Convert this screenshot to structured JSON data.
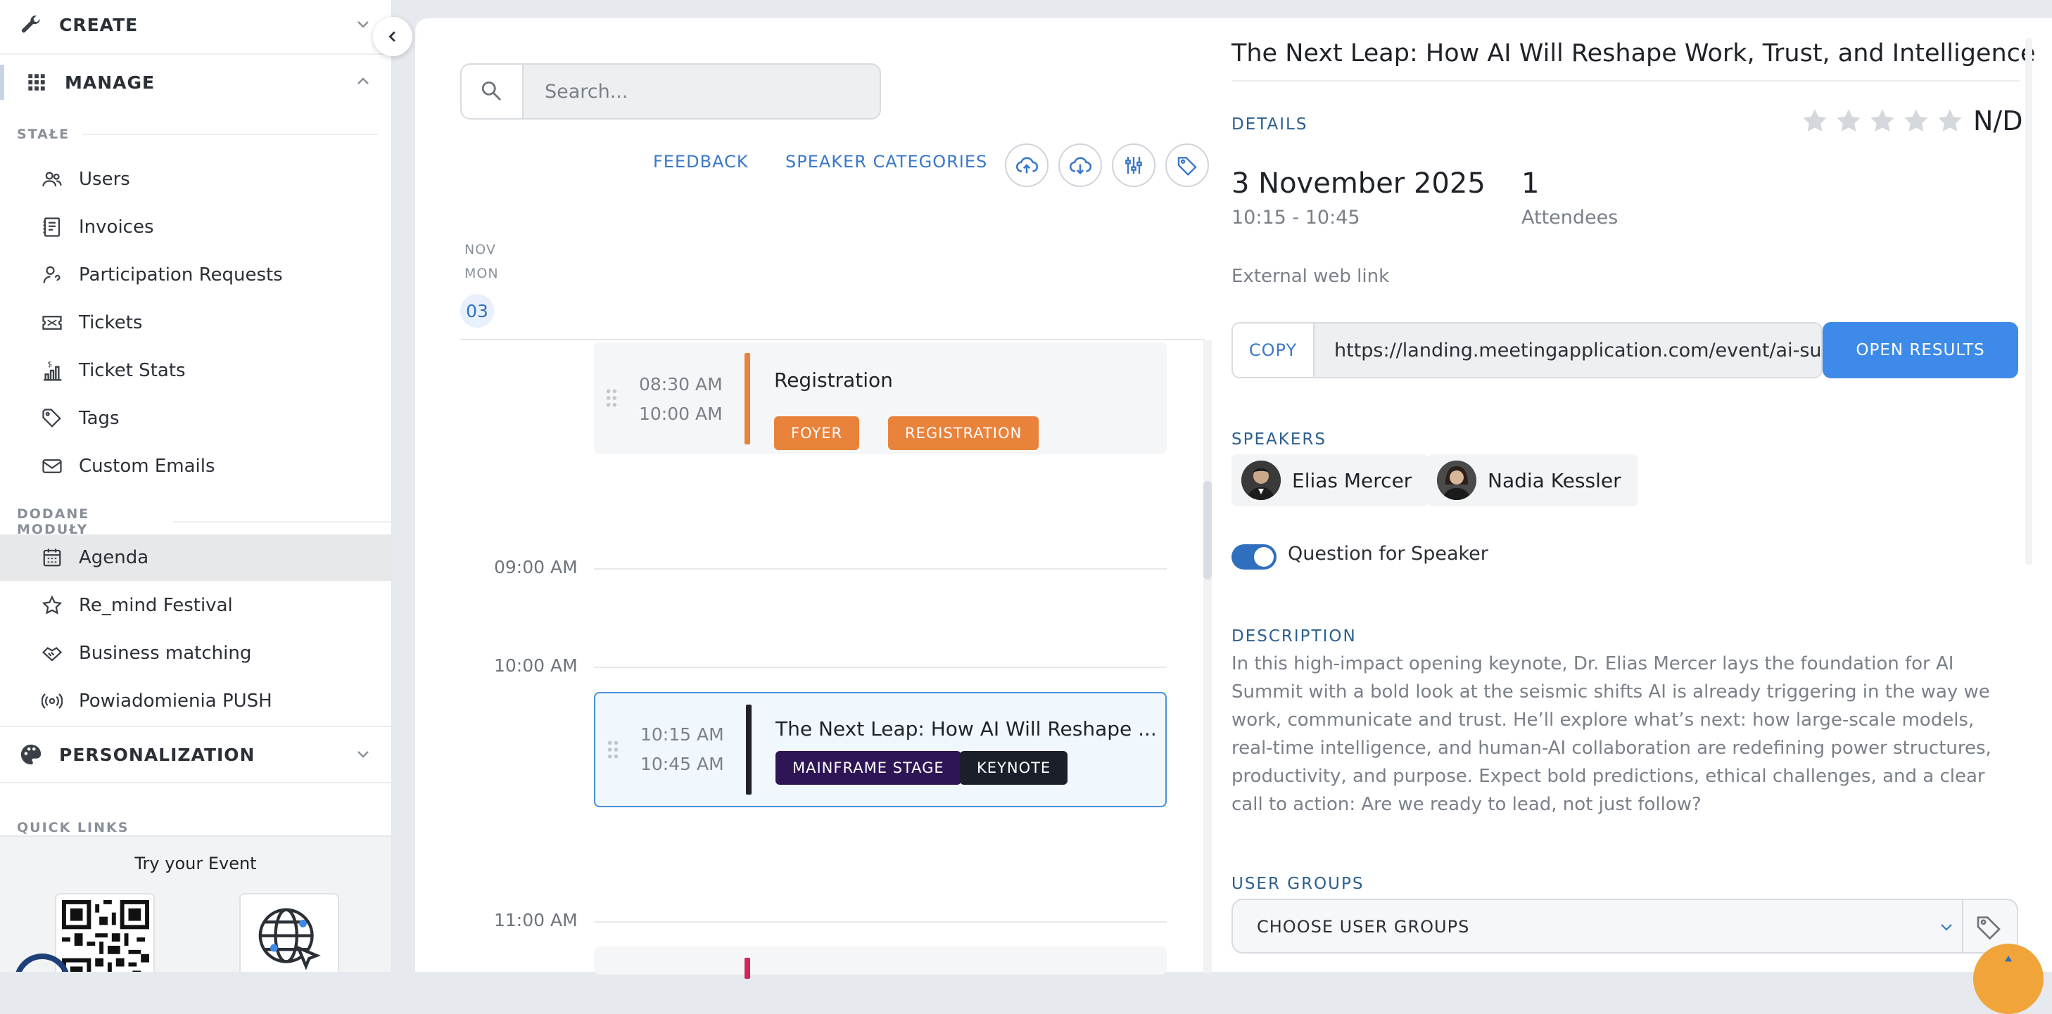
{
  "sidebar": {
    "create_label": "CREATE",
    "manage_label": "MANAGE",
    "group_stale": "STAŁE",
    "group_modules": "DODANE MODUŁY",
    "items": [
      {
        "label": "Users"
      },
      {
        "label": "Invoices"
      },
      {
        "label": "Participation Requests"
      },
      {
        "label": "Tickets"
      },
      {
        "label": "Ticket Stats"
      },
      {
        "label": "Tags"
      },
      {
        "label": "Custom Emails"
      }
    ],
    "modules": [
      {
        "label": "Agenda"
      },
      {
        "label": "Re_mind Festival"
      },
      {
        "label": "Business matching"
      },
      {
        "label": "Powiadomienia PUSH"
      }
    ],
    "personalization_label": "PERSONALIZATION",
    "quick_links_label": "QUICK LINKS",
    "try_event_label": "Try your Event"
  },
  "toolbar": {
    "search_placeholder": "Search...",
    "feedback_label": "FEEDBACK",
    "speaker_categories_label": "SPEAKER CATEGORIES"
  },
  "calendar": {
    "month": "NOV",
    "weekday": "MON",
    "day": "03",
    "hours": [
      "09:00 AM",
      "10:00 AM",
      "11:00 AM"
    ],
    "events": [
      {
        "start": "08:30 AM",
        "end": "10:00 AM",
        "title": "Registration",
        "tags": [
          "FOYER",
          "REGISTRATION"
        ]
      },
      {
        "start": "10:15 AM",
        "end": "10:45 AM",
        "title": "The Next Leap: How AI Will Reshape ...",
        "tags": [
          "MAINFRAME STAGE",
          "KEYNOTE"
        ]
      }
    ]
  },
  "detail": {
    "title": "The Next Leap: How AI Will Reshape Work, Trust, and Intelligence",
    "details_label": "DETAILS",
    "rating": "N/D",
    "date": "3 November 2025",
    "time": "10:15 - 10:45",
    "attendees_count": "1",
    "attendees_label": "Attendees",
    "external_link_label": "External web link",
    "copy_label": "COPY",
    "url": "https://landing.meetingapplication.com/event/ai-summit",
    "open_results_label": "OPEN RESULTS",
    "speakers_label": "SPEAKERS",
    "speakers": [
      {
        "name": "Elias Mercer"
      },
      {
        "name": "Nadia Kessler"
      }
    ],
    "question_toggle_label": "Question for Speaker",
    "description_label": "DESCRIPTION",
    "description": "In this high-impact opening keynote, Dr. Elias Mercer lays the foundation for AI Summit with a bold look at the seismic shifts AI is already triggering in the way we work, communicate and trust. He’ll explore what’s next: how large-scale models, real-time intelligence, and human-AI collaboration are redefining power structures, productivity, and purpose. Expect bold predictions, ethical challenges, and a clear call to action: Are we ready to lead, not just follow?",
    "user_groups_label": "USER GROUPS",
    "choose_user_groups_label": "CHOOSE USER GROUPS"
  },
  "colors": {
    "accent": "#3a78c9",
    "registration_bar": "#e9823a",
    "keynote_bar": "#1f2329",
    "stage_tag": "#2e1556",
    "keynote_tag": "#1b1f2a",
    "toggle": "#2f6fbd"
  },
  "icons": {
    "create": "wrench-icon",
    "manage": "grid-icon",
    "personalization": "palette-icon",
    "search": "search-icon",
    "star": "star-icon"
  }
}
